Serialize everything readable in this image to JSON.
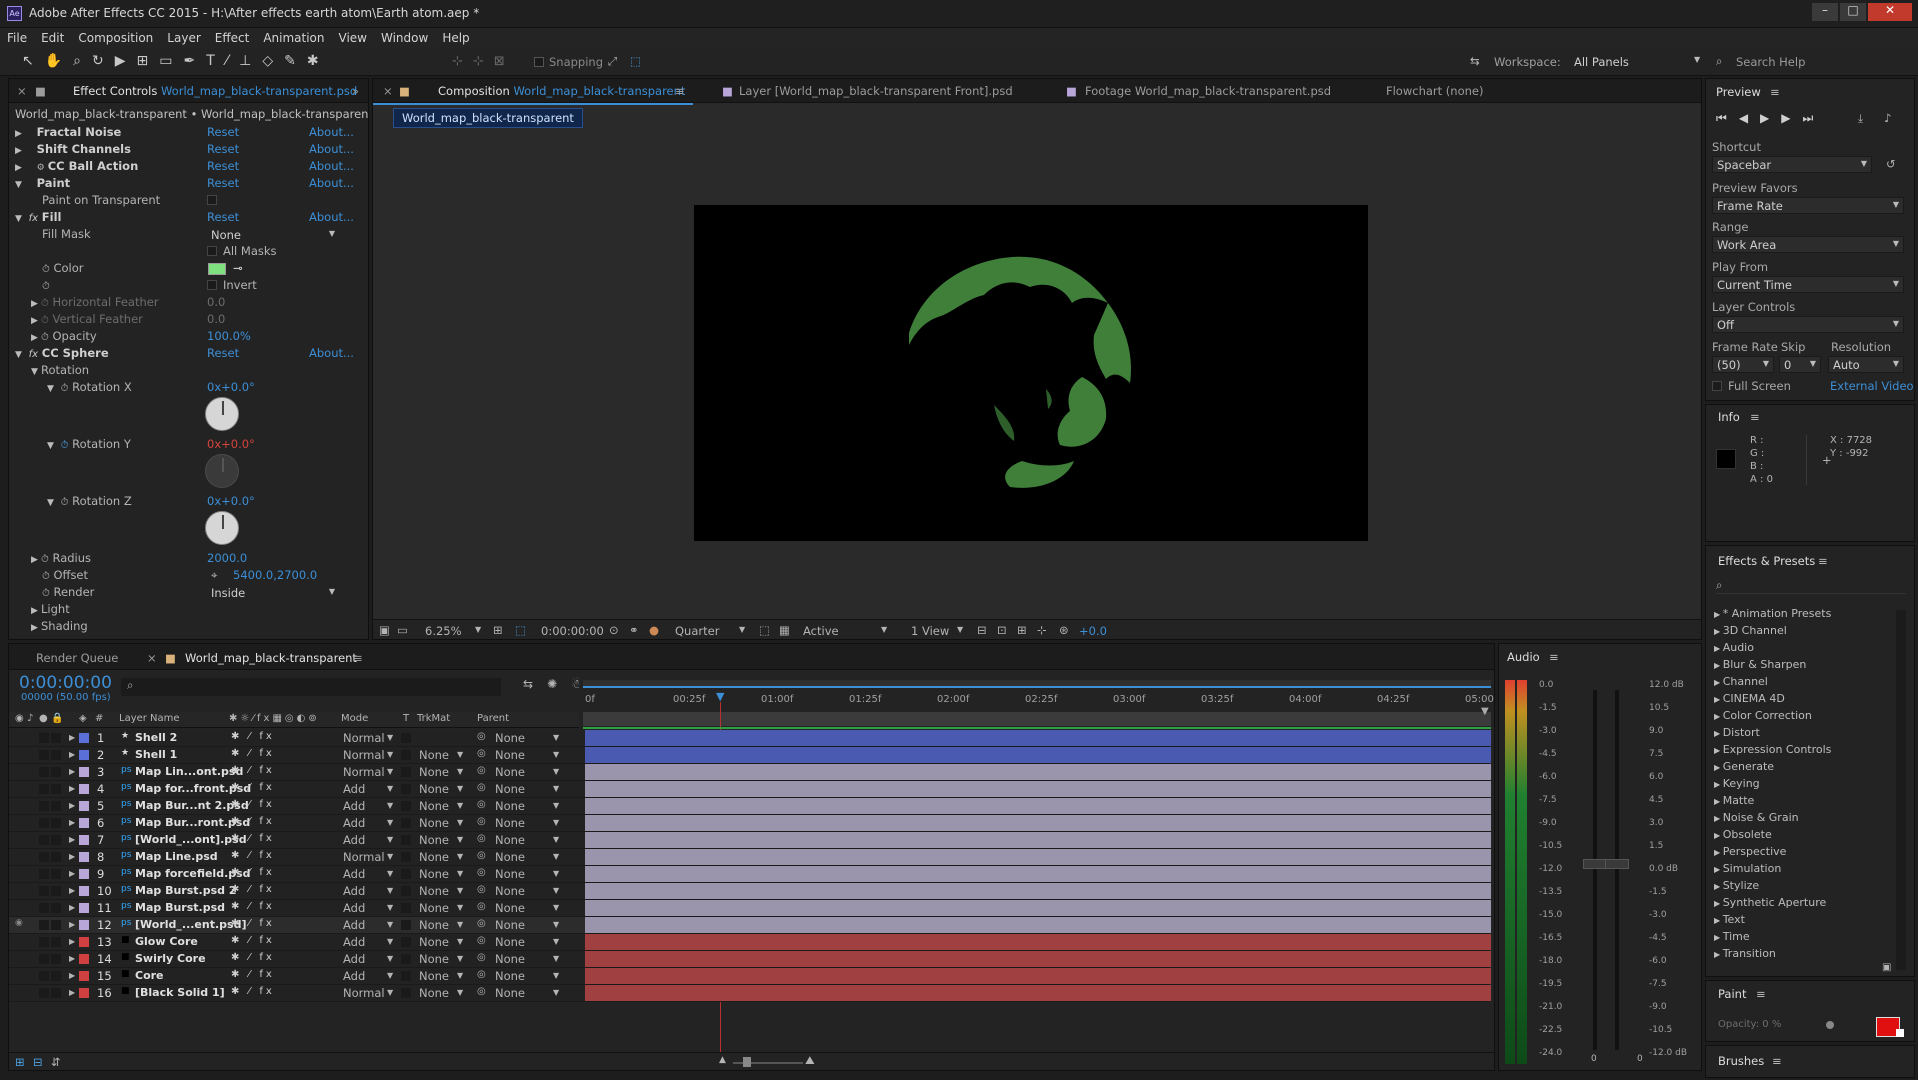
{
  "window": {
    "title": "Adobe After Effects CC 2015 - H:\\After effects earth atom\\Earth atom.aep *",
    "min": "–",
    "max": "□",
    "close": "✕"
  },
  "menu": [
    "File",
    "Edit",
    "Composition",
    "Layer",
    "Effect",
    "Animation",
    "View",
    "Window",
    "Help"
  ],
  "toolbar": {
    "snapping": "Snapping",
    "workspace_label": "Workspace:",
    "workspace_value": "All Panels",
    "search_placeholder": "Search Help"
  },
  "effect_controls": {
    "tab_label": "Effect Controls",
    "tab_file": "World_map_black-transparent.psd",
    "breadcrumb": "World_map_black-transparent • World_map_black-transparent.psd",
    "reset": "Reset",
    "about": "About...",
    "effects": {
      "fractal_noise": "Fractal Noise",
      "shift_channels": "Shift Channels",
      "cc_ball_action": "CC Ball Action",
      "paint": "Paint",
      "paint_on_transparent": "Paint on Transparent",
      "fill": "Fill",
      "fill_mask": "Fill Mask",
      "fill_mask_value": "None",
      "all_masks": "All Masks",
      "color": "Color",
      "invert": "Invert",
      "horizontal_feather": "Horizontal Feather",
      "horizontal_feather_value": "0.0",
      "vertical_feather": "Vertical Feather",
      "vertical_feather_value": "0.0",
      "opacity": "Opacity",
      "opacity_value": "100.0%",
      "cc_sphere": "CC Sphere",
      "rotation": "Rotation",
      "rotation_x": "Rotation X",
      "rotation_x_value": "0x+0.0°",
      "rotation_y": "Rotation Y",
      "rotation_y_value": "0x+0.0°",
      "rotation_z": "Rotation Z",
      "rotation_z_value": "0x+0.0°",
      "radius": "Radius",
      "radius_value": "2000.0",
      "offset": "Offset",
      "offset_value": "5400.0,2700.0",
      "render": "Render",
      "render_value": "Inside",
      "light": "Light",
      "shading": "Shading"
    }
  },
  "composition": {
    "tab_comp": "Composition",
    "tab_comp_name": "World_map_black-transparent",
    "tab_layer": "Layer [World_map_black-transparent Front].psd",
    "tab_footage": "Footage World_map_black-transparent.psd",
    "tab_flowchart": "Flowchart (none)",
    "chip": "World_map_black-transparent",
    "zoom": "6.25%",
    "timecode": "0:00:00:00",
    "resolution": "Quarter",
    "camera": "Active Camera",
    "views": "1 View",
    "exposure": "+0.0"
  },
  "timeline": {
    "tab_render_queue": "Render Queue",
    "tab_comp": "World_map_black-transparent",
    "timecode": "0:00:00:00",
    "fps": "00000 (50.00 fps)",
    "col_num": "#",
    "col_layer": "Layer Name",
    "col_mode": "Mode",
    "col_t": "T",
    "col_trkmat": "TrkMat",
    "col_parent": "Parent",
    "ruler": [
      "0f",
      "00:25f",
      "01:00f",
      "01:25f",
      "02:00f",
      "02:25f",
      "03:00f",
      "03:25f",
      "04:00f",
      "04:25f",
      "05:00"
    ],
    "layers": [
      {
        "num": "1",
        "name": "Shell 2",
        "mode": "Normal",
        "trkmat": "",
        "parent": "None",
        "label": "#5b6fd8",
        "icon": "★",
        "bar": "#4a5ab0"
      },
      {
        "num": "2",
        "name": "Shell 1",
        "mode": "Normal",
        "trkmat": "None",
        "parent": "None",
        "label": "#5b6fd8",
        "icon": "★",
        "bar": "#4a5ab0"
      },
      {
        "num": "3",
        "name": "Map Lin...ont.psd",
        "mode": "Normal",
        "trkmat": "None",
        "parent": "None",
        "label": "#b8a6d8",
        "icon": "ps",
        "bar": "#9a95ad"
      },
      {
        "num": "4",
        "name": "Map for...front.psd",
        "mode": "Add",
        "trkmat": "None",
        "parent": "None",
        "label": "#b8a6d8",
        "icon": "ps",
        "bar": "#9a95ad"
      },
      {
        "num": "5",
        "name": "Map Bur...nt 2.psd",
        "mode": "Add",
        "trkmat": "None",
        "parent": "None",
        "label": "#b8a6d8",
        "icon": "ps",
        "bar": "#9a95ad"
      },
      {
        "num": "6",
        "name": "Map Bur...ront.psd",
        "mode": "Add",
        "trkmat": "None",
        "parent": "None",
        "label": "#b8a6d8",
        "icon": "ps",
        "bar": "#9a95ad"
      },
      {
        "num": "7",
        "name": "[World_...ont].psd",
        "mode": "Add",
        "trkmat": "None",
        "parent": "None",
        "label": "#b8a6d8",
        "icon": "ps",
        "bar": "#9a95ad"
      },
      {
        "num": "8",
        "name": "Map Line.psd",
        "mode": "Normal",
        "trkmat": "None",
        "parent": "None",
        "label": "#b8a6d8",
        "icon": "ps",
        "bar": "#9a95ad"
      },
      {
        "num": "9",
        "name": "Map forcefield.psd",
        "mode": "Add",
        "trkmat": "None",
        "parent": "None",
        "label": "#b8a6d8",
        "icon": "ps",
        "bar": "#9a95ad"
      },
      {
        "num": "10",
        "name": "Map Burst.psd 2",
        "mode": "Add",
        "trkmat": "None",
        "parent": "None",
        "label": "#b8a6d8",
        "icon": "ps",
        "bar": "#9a95ad"
      },
      {
        "num": "11",
        "name": "Map Burst.psd",
        "mode": "Add",
        "trkmat": "None",
        "parent": "None",
        "label": "#b8a6d8",
        "icon": "ps",
        "bar": "#9a95ad"
      },
      {
        "num": "12",
        "name": "[World_...ent.psd]",
        "mode": "Add",
        "trkmat": "None",
        "parent": "None",
        "label": "#b8a6d8",
        "icon": "ps",
        "bar": "#9a95ad"
      },
      {
        "num": "13",
        "name": "Glow Core",
        "mode": "Add",
        "trkmat": "None",
        "parent": "None",
        "label": "#d04040",
        "icon": "■",
        "bar": "#a04040"
      },
      {
        "num": "14",
        "name": "Swirly Core",
        "mode": "Add",
        "trkmat": "None",
        "parent": "None",
        "label": "#d04040",
        "icon": "■",
        "bar": "#a04040"
      },
      {
        "num": "15",
        "name": "Core",
        "mode": "Add",
        "trkmat": "None",
        "parent": "None",
        "label": "#d04040",
        "icon": "■",
        "bar": "#a04040"
      },
      {
        "num": "16",
        "name": "[Black Solid 1]",
        "mode": "Normal",
        "trkmat": "None",
        "parent": "None",
        "label": "#d04040",
        "icon": "■",
        "bar": "#a04040"
      }
    ]
  },
  "audio": {
    "title": "Audio",
    "left_scale": [
      "0.0",
      "-1.5",
      "-3.0",
      "-4.5",
      "-6.0",
      "-7.5",
      "-9.0",
      "-10.5",
      "-12.0",
      "-13.5",
      "-15.0",
      "-16.5",
      "-18.0",
      "-19.5",
      "-21.0",
      "-22.5",
      "-24.0"
    ],
    "right_scale": [
      "12.0 dB",
      "10.5",
      "9.0",
      "7.5",
      "6.0",
      "4.5",
      "3.0",
      "1.5",
      "0.0 dB",
      "-1.5",
      "-3.0",
      "-4.5",
      "-6.0",
      "-7.5",
      "-9.0",
      "-10.5",
      "-12.0 dB"
    ],
    "ch_l": "0",
    "ch_r": "0"
  },
  "preview": {
    "title": "Preview",
    "shortcut_label": "Shortcut",
    "shortcut_value": "Spacebar",
    "favors_label": "Preview Favors",
    "favors_value": "Frame Rate",
    "range_label": "Range",
    "range_value": "Work Area",
    "playfrom_label": "Play From",
    "playfrom_value": "Current Time",
    "layerctl_label": "Layer Controls",
    "layerctl_value": "Off",
    "framerate_label": "Frame Rate",
    "framerate_value": "(50)",
    "skip_label": "Skip",
    "skip_value": "0",
    "resolution_label": "Resolution",
    "resolution_value": "Auto",
    "fullscreen": "Full Screen",
    "external": "External Video"
  },
  "info": {
    "title": "Info",
    "r": "R :",
    "g": "G :",
    "b": "B :",
    "a": "A : 0",
    "x": "X : 7728",
    "y": "Y : -992"
  },
  "effects_presets": {
    "title": "Effects & Presets",
    "items": [
      "* Animation Presets",
      "3D Channel",
      "Audio",
      "Blur & Sharpen",
      "Channel",
      "CINEMA 4D",
      "Color Correction",
      "Distort",
      "Expression Controls",
      "Generate",
      "Keying",
      "Matte",
      "Noise & Grain",
      "Obsolete",
      "Perspective",
      "Simulation",
      "Stylize",
      "Synthetic Aperture",
      "Text",
      "Time",
      "Transition"
    ]
  },
  "paint": {
    "title": "Paint",
    "opacity": "Opacity:  0 %"
  },
  "brushes": {
    "title": "Brushes"
  },
  "colors": {
    "accent": "#3c8fd6",
    "fill_color": "#7fe07f",
    "map_green": "#3f7f3a",
    "fg_swatch": "#e01010"
  }
}
